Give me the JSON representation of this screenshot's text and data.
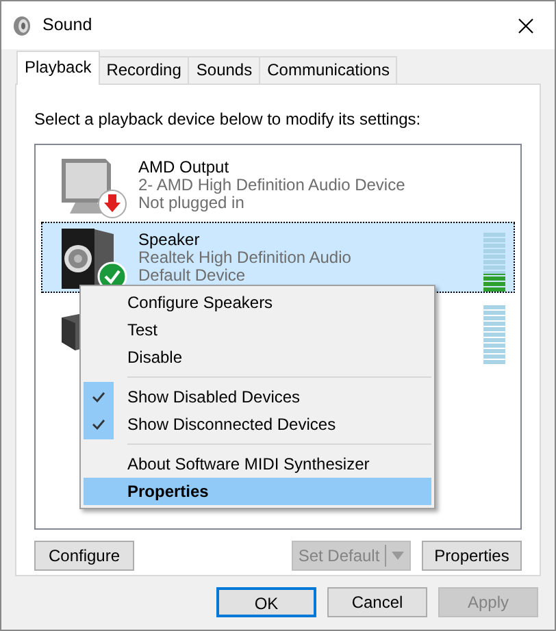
{
  "window": {
    "title": "Sound"
  },
  "tabs": [
    {
      "label": "Playback",
      "selected": true
    },
    {
      "label": "Recording",
      "selected": false
    },
    {
      "label": "Sounds",
      "selected": false
    },
    {
      "label": "Communications",
      "selected": false
    }
  ],
  "instruction": "Select a playback device below to modify its settings:",
  "devices": [
    {
      "kind": "monitor",
      "unplugged": true,
      "name": "AMD Output",
      "description": "2- AMD High Definition Audio Device",
      "state": "Not plugged in",
      "selected": false
    },
    {
      "kind": "speaker",
      "default_device": true,
      "name": "Speaker",
      "description": "Realtek High Definition Audio",
      "state": "Default Device",
      "selected": true,
      "level": 0.3
    },
    {
      "kind": "receiver",
      "selected": false,
      "level": 0
    }
  ],
  "context_menu": [
    {
      "kind": "item",
      "label": "Configure Speakers",
      "checked": false,
      "selected": false
    },
    {
      "kind": "item",
      "label": "Test",
      "checked": false,
      "selected": false
    },
    {
      "kind": "item",
      "label": "Disable",
      "checked": false,
      "selected": false
    },
    {
      "kind": "separator"
    },
    {
      "kind": "item",
      "label": "Show Disabled Devices",
      "checked": true,
      "selected": false
    },
    {
      "kind": "item",
      "label": "Show Disconnected Devices",
      "checked": true,
      "selected": false
    },
    {
      "kind": "separator"
    },
    {
      "kind": "item",
      "label": "About Software MIDI Synthesizer",
      "checked": false,
      "selected": false
    },
    {
      "kind": "item",
      "label": "Properties",
      "checked": false,
      "selected": true,
      "bold": true
    }
  ],
  "panel_buttons": [
    {
      "label": "Configure",
      "disabled": false
    },
    {
      "label": "Set Default",
      "disabled": true,
      "split": true
    },
    {
      "label": "Properties",
      "disabled": false
    }
  ],
  "dialog_buttons": [
    {
      "label": "OK",
      "disabled": false,
      "default": true
    },
    {
      "label": "Cancel",
      "disabled": false,
      "default": false
    },
    {
      "label": "Apply",
      "disabled": true,
      "default": false
    }
  ]
}
